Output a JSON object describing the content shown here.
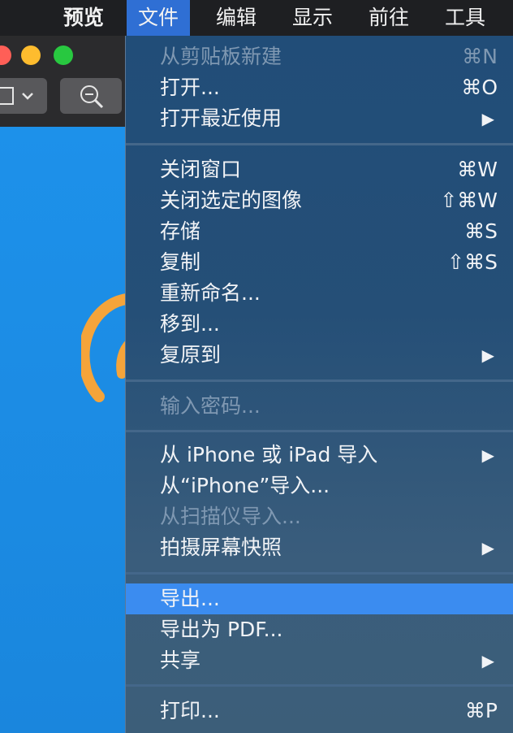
{
  "menubar": {
    "app": "预览",
    "items": [
      "文件",
      "编辑",
      "显示",
      "前往",
      "工具"
    ]
  },
  "file_menu": {
    "items": [
      {
        "label": "从剪贴板新建",
        "shortcut": "⌘N",
        "disabled": true
      },
      {
        "label": "打开...",
        "shortcut": "⌘O"
      },
      {
        "label": "打开最近使用",
        "arrow": "▶"
      },
      {
        "label": "关闭窗口",
        "shortcut": "⌘W"
      },
      {
        "label": "关闭选定的图像",
        "shortcut": "⇧⌘W"
      },
      {
        "label": "存储",
        "shortcut": "⌘S"
      },
      {
        "label": "复制",
        "shortcut": "⇧⌘S"
      },
      {
        "label": "重新命名..."
      },
      {
        "label": "移到..."
      },
      {
        "label": "复原到",
        "arrow": "▶"
      },
      {
        "label": "输入密码...",
        "disabled": true
      },
      {
        "label": "从 iPhone 或 iPad 导入",
        "arrow": "▶"
      },
      {
        "label": "从“iPhone”导入..."
      },
      {
        "label": "从扫描仪导入...",
        "disabled": true
      },
      {
        "label": "拍摄屏幕快照",
        "arrow": "▶"
      },
      {
        "label": "导出...",
        "highlighted": true
      },
      {
        "label": "导出为 PDF..."
      },
      {
        "label": "共享",
        "arrow": "▶"
      },
      {
        "label": "打印...",
        "shortcut": "⌘P"
      }
    ]
  },
  "colors": {
    "highlight": "#3b8cf0",
    "menubar_active": "#2f6fd4",
    "traffic_red": "#ff5f57",
    "traffic_yellow": "#febc2e",
    "traffic_green": "#28c840",
    "accent_orange": "#f5a43a"
  }
}
